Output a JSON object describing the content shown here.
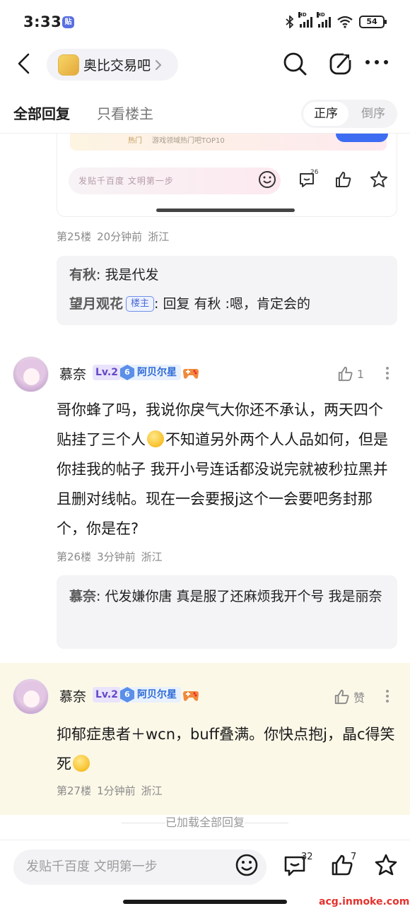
{
  "status_bar": {
    "time": "3:33",
    "app_badge": "贴",
    "battery": "54",
    "signal_label": "HD",
    "wifi_label": "6"
  },
  "nav": {
    "forum_name": "奥比交易吧"
  },
  "tabs": {
    "all_replies": "全部回复",
    "only_op": "只看楼主",
    "order_asc": "正序",
    "order_desc": "倒序"
  },
  "embed": {
    "hot": "热门",
    "top_text": "游戏领域热门吧TOP10",
    "input_placeholder": "发贴千百度 文明第一步",
    "comment_count": "26"
  },
  "floor25": {
    "floor": "第25楼",
    "time": "20分钟前",
    "location": "浙江",
    "replies": [
      {
        "name": "有秋",
        "separator": ":",
        "text": " 我是代发"
      },
      {
        "name": "望月观花",
        "tag": "楼主",
        "separator": ":",
        "text": " 回复 有秋 :嗯，肯定会的"
      }
    ]
  },
  "floor26": {
    "author": "慕奈",
    "level": "Lv.2",
    "badge_num": "6",
    "badge_name": "阿贝尔星",
    "likes": "1",
    "content_part1": "哥你蜂了吗，我说你戾气大你还不承认，两天四个贴挂了三个人",
    "content_part2": "不知道另外两个人人品如何，但是你挂我的帖子 我开小号连话都没说完就被秒拉黑并且删对线帖。现在一会要报j这个一会要吧务封那个，你是在?",
    "floor": "第26楼",
    "time": "3分钟前",
    "location": "浙江",
    "reply": {
      "name": "慕奈",
      "separator": ":",
      "text": " 代发嫌你唐 真是服了还麻烦我开个号 我是丽奈"
    }
  },
  "floor27": {
    "author": "慕奈",
    "level": "Lv.2",
    "badge_num": "6",
    "badge_name": "阿贝尔星",
    "likes": "赞",
    "content": "抑郁症患者＋wcn，buff叠满。你快点抱j，晶c得笑死",
    "floor": "第27楼",
    "time": "1分钟前",
    "location": "浙江"
  },
  "all_loaded": "已加载全部回复",
  "bottom": {
    "placeholder": "发贴千百度 文明第一步",
    "comment_count": "32",
    "like_count": "7"
  },
  "watermark": "acg.inmoke.com",
  "colors": {
    "op_tag": "#4a6ad6",
    "level": "#6448c8",
    "badge": "#2f6bd6",
    "highlight_bg": "#fcf8e8",
    "watermark": "#e5322d"
  }
}
